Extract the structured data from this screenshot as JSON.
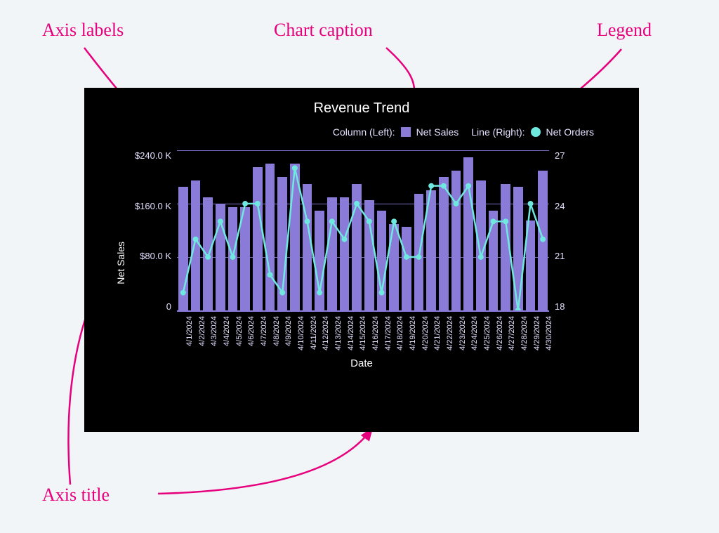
{
  "callouts": {
    "axis_labels": "Axis labels",
    "chart_caption": "Chart caption",
    "legend": "Legend",
    "axis_title": "Axis title"
  },
  "chart": {
    "title": "Revenue Trend",
    "legend_left_label": "Column (Left):",
    "legend_left_series": "Net Sales",
    "legend_right_label": "Line (Right):",
    "legend_right_series": "Net Orders",
    "y_left_title": "Net Sales",
    "x_title": "Date",
    "y_left_ticks": [
      "$240.0 K",
      "$160.0 K",
      "$80.0 K",
      "0"
    ],
    "y_right_ticks": [
      "27",
      "24",
      "21",
      "18"
    ],
    "categories": [
      "4/1/2024",
      "4/2/2024",
      "4/3/2024",
      "4/4/2024",
      "4/5/2024",
      "4/6/2024",
      "4/7/2024",
      "4/8/2024",
      "4/9/2024",
      "4/10/2024",
      "4/11/2024",
      "4/12/2024",
      "4/13/2024",
      "4/14/2024",
      "4/15/2024",
      "4/16/2024",
      "4/17/2024",
      "4/18/2024",
      "4/19/2024",
      "4/20/2024",
      "4/21/2024",
      "4/22/2024",
      "4/23/2024",
      "4/24/2024",
      "4/25/2024",
      "4/26/2024",
      "4/27/2024",
      "4/28/2024",
      "4/29/2024",
      "4/30/2024"
    ]
  },
  "chart_data": {
    "type": "bar+line",
    "title": "Revenue Trend",
    "xlabel": "Date",
    "y_left": {
      "label": "Net Sales",
      "unit": "$K",
      "lim": [
        0,
        240
      ],
      "ticks": [
        0,
        80,
        160,
        240
      ]
    },
    "y_right": {
      "label": "Net Orders",
      "lim": [
        18,
        27
      ],
      "ticks": [
        18,
        21,
        24,
        27
      ]
    },
    "categories": [
      "4/1/2024",
      "4/2/2024",
      "4/3/2024",
      "4/4/2024",
      "4/5/2024",
      "4/6/2024",
      "4/7/2024",
      "4/8/2024",
      "4/9/2024",
      "4/10/2024",
      "4/11/2024",
      "4/12/2024",
      "4/13/2024",
      "4/14/2024",
      "4/15/2024",
      "4/16/2024",
      "4/17/2024",
      "4/18/2024",
      "4/19/2024",
      "4/20/2024",
      "4/21/2024",
      "4/22/2024",
      "4/23/2024",
      "4/24/2024",
      "4/25/2024",
      "4/26/2024",
      "4/27/2024",
      "4/28/2024",
      "4/29/2024",
      "4/30/2024"
    ],
    "series": [
      {
        "name": "Net Sales",
        "kind": "bar",
        "axis": "left",
        "values": [
          185,
          195,
          170,
          160,
          155,
          155,
          215,
          220,
          200,
          220,
          190,
          150,
          170,
          170,
          190,
          165,
          150,
          130,
          125,
          175,
          180,
          200,
          210,
          230,
          195,
          150,
          190,
          185,
          135,
          210
        ]
      },
      {
        "name": "Net Orders",
        "kind": "line",
        "axis": "right",
        "values": [
          19,
          22,
          21,
          23,
          21,
          24,
          24,
          20,
          19,
          26,
          23,
          19,
          23,
          22,
          24,
          23,
          19,
          23,
          21,
          21,
          25,
          25,
          24,
          25,
          21,
          23,
          23,
          18,
          24,
          22
        ]
      }
    ],
    "legend_position": "top-right"
  }
}
